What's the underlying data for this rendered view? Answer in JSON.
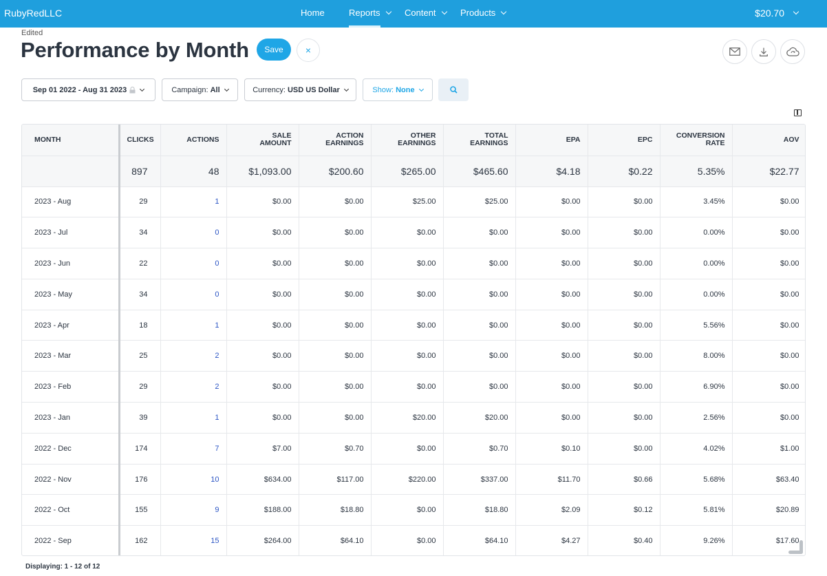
{
  "app": {
    "brand": "RubyRedLLC",
    "nav": [
      {
        "label": "Home"
      },
      {
        "label": "Reports"
      },
      {
        "label": "Content"
      },
      {
        "label": "Products"
      }
    ],
    "balance": "$20.70"
  },
  "header": {
    "status": "Edited",
    "title": "Performance by Month",
    "save_label": "Save",
    "close_glyph": "×"
  },
  "icons": {
    "email": "envelope-icon",
    "download": "download-icon",
    "cloud": "cloud-refresh-icon",
    "search": "search-icon",
    "columns": "columns-icon",
    "lock": "lock-icon"
  },
  "filters": {
    "date_range": "Sep 01 2022 - Aug 31 2023",
    "campaign_label": "Campaign:",
    "campaign_value": "All",
    "currency_label": "Currency:",
    "currency_value": "USD US Dollar",
    "show_label": "Show:",
    "show_value": "None"
  },
  "colors": {
    "primary": "#1fa6e6",
    "topbar": "#1f9fdd",
    "action_link": "#2a54c4"
  },
  "table": {
    "headers": {
      "month": "MONTH",
      "clicks": "CLICKS",
      "actions": "ACTIONS",
      "sale_amount_1": "SALE",
      "sale_amount_2": "AMOUNT",
      "action_earnings_1": "ACTION",
      "action_earnings_2": "EARNINGS",
      "other_earnings_1": "OTHER",
      "other_earnings_2": "EARNINGS",
      "total_earnings_1": "TOTAL",
      "total_earnings_2": "EARNINGS",
      "epa": "EPA",
      "epc": "EPC",
      "conversion_rate_1": "CONVERSION",
      "conversion_rate_2": "RATE",
      "aov": "AOV"
    },
    "totals": {
      "clicks": "897",
      "actions": "48",
      "sale_amount": "$1,093.00",
      "action_earnings": "$200.60",
      "other_earnings": "$265.00",
      "total_earnings": "$465.60",
      "epa": "$4.18",
      "epc": "$0.22",
      "conversion_rate": "5.35%",
      "aov": "$22.77"
    },
    "rows": [
      {
        "month": "2023 - Aug",
        "clicks": "29",
        "actions": "1",
        "sale_amount": "$0.00",
        "action_earnings": "$0.00",
        "other_earnings": "$25.00",
        "total_earnings": "$25.00",
        "epa": "$0.00",
        "epc": "$0.00",
        "conversion_rate": "3.45%",
        "aov": "$0.00"
      },
      {
        "month": "2023 - Jul",
        "clicks": "34",
        "actions": "0",
        "sale_amount": "$0.00",
        "action_earnings": "$0.00",
        "other_earnings": "$0.00",
        "total_earnings": "$0.00",
        "epa": "$0.00",
        "epc": "$0.00",
        "conversion_rate": "0.00%",
        "aov": "$0.00"
      },
      {
        "month": "2023 - Jun",
        "clicks": "22",
        "actions": "0",
        "sale_amount": "$0.00",
        "action_earnings": "$0.00",
        "other_earnings": "$0.00",
        "total_earnings": "$0.00",
        "epa": "$0.00",
        "epc": "$0.00",
        "conversion_rate": "0.00%",
        "aov": "$0.00"
      },
      {
        "month": "2023 - May",
        "clicks": "34",
        "actions": "0",
        "sale_amount": "$0.00",
        "action_earnings": "$0.00",
        "other_earnings": "$0.00",
        "total_earnings": "$0.00",
        "epa": "$0.00",
        "epc": "$0.00",
        "conversion_rate": "0.00%",
        "aov": "$0.00"
      },
      {
        "month": "2023 - Apr",
        "clicks": "18",
        "actions": "1",
        "sale_amount": "$0.00",
        "action_earnings": "$0.00",
        "other_earnings": "$0.00",
        "total_earnings": "$0.00",
        "epa": "$0.00",
        "epc": "$0.00",
        "conversion_rate": "5.56%",
        "aov": "$0.00"
      },
      {
        "month": "2023 - Mar",
        "clicks": "25",
        "actions": "2",
        "sale_amount": "$0.00",
        "action_earnings": "$0.00",
        "other_earnings": "$0.00",
        "total_earnings": "$0.00",
        "epa": "$0.00",
        "epc": "$0.00",
        "conversion_rate": "8.00%",
        "aov": "$0.00"
      },
      {
        "month": "2023 - Feb",
        "clicks": "29",
        "actions": "2",
        "sale_amount": "$0.00",
        "action_earnings": "$0.00",
        "other_earnings": "$0.00",
        "total_earnings": "$0.00",
        "epa": "$0.00",
        "epc": "$0.00",
        "conversion_rate": "6.90%",
        "aov": "$0.00"
      },
      {
        "month": "2023 - Jan",
        "clicks": "39",
        "actions": "1",
        "sale_amount": "$0.00",
        "action_earnings": "$0.00",
        "other_earnings": "$20.00",
        "total_earnings": "$20.00",
        "epa": "$0.00",
        "epc": "$0.00",
        "conversion_rate": "2.56%",
        "aov": "$0.00"
      },
      {
        "month": "2022 - Dec",
        "clicks": "174",
        "actions": "7",
        "sale_amount": "$7.00",
        "action_earnings": "$0.70",
        "other_earnings": "$0.00",
        "total_earnings": "$0.70",
        "epa": "$0.10",
        "epc": "$0.00",
        "conversion_rate": "4.02%",
        "aov": "$1.00"
      },
      {
        "month": "2022 - Nov",
        "clicks": "176",
        "actions": "10",
        "sale_amount": "$634.00",
        "action_earnings": "$117.00",
        "other_earnings": "$220.00",
        "total_earnings": "$337.00",
        "epa": "$11.70",
        "epc": "$0.66",
        "conversion_rate": "5.68%",
        "aov": "$63.40"
      },
      {
        "month": "2022 - Oct",
        "clicks": "155",
        "actions": "9",
        "sale_amount": "$188.00",
        "action_earnings": "$18.80",
        "other_earnings": "$0.00",
        "total_earnings": "$18.80",
        "epa": "$2.09",
        "epc": "$0.12",
        "conversion_rate": "5.81%",
        "aov": "$20.89"
      },
      {
        "month": "2022 - Sep",
        "clicks": "162",
        "actions": "15",
        "sale_amount": "$264.00",
        "action_earnings": "$64.10",
        "other_earnings": "$0.00",
        "total_earnings": "$64.10",
        "epa": "$4.27",
        "epc": "$0.40",
        "conversion_rate": "9.26%",
        "aov": "$17.60"
      }
    ]
  },
  "footer": {
    "displaying": "Displaying: 1 - 12 of 12"
  }
}
